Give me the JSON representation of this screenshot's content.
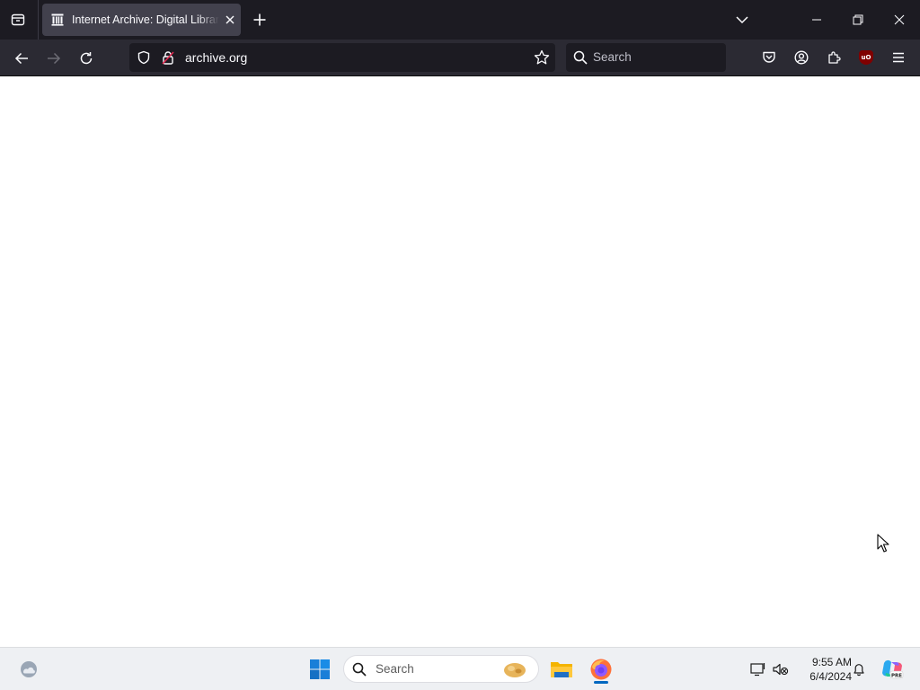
{
  "browser": {
    "tab": {
      "title": "Internet Archive: Digital Library",
      "favicon": "archive-columns-icon"
    },
    "urlbar": {
      "url": "archive.org"
    },
    "searchbar": {
      "placeholder": "Search"
    },
    "extension_ublock_label": "uO",
    "colors": {
      "tabstrip": "#1c1b22",
      "tab_active": "#42414d",
      "navbar": "#2b2a33",
      "field": "#1c1b22",
      "text": "#fbfbfe"
    }
  },
  "taskbar": {
    "search": {
      "placeholder": "Search"
    },
    "clock": {
      "time": "9:55 AM",
      "date": "6/4/2024"
    },
    "apps": [
      "file-explorer",
      "firefox"
    ],
    "copilot_badge": "PRE",
    "colors": {
      "background": "#eef0f3",
      "accent": "#0067c0"
    }
  }
}
